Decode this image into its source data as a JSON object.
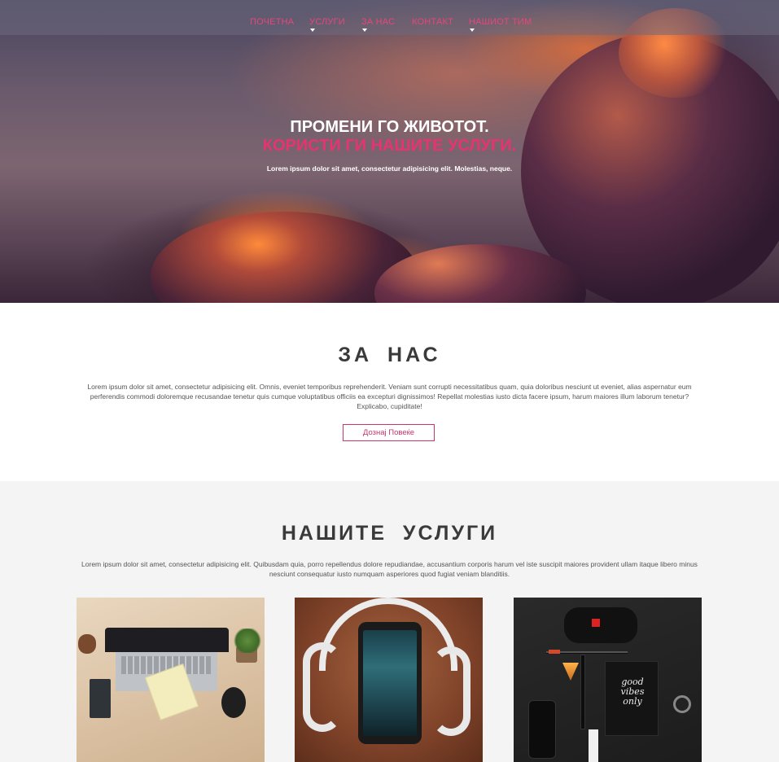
{
  "nav": {
    "items": [
      {
        "label": "ПОЧЕТНА",
        "dropdown": false
      },
      {
        "label": "УСЛУГИ",
        "dropdown": true
      },
      {
        "label": "ЗА НАС",
        "dropdown": true
      },
      {
        "label": "КОНТАКТ",
        "dropdown": false
      },
      {
        "label": "НАШИОТ ТИМ",
        "dropdown": true
      }
    ]
  },
  "hero": {
    "title": "ПРОМЕНИ ГО ЖИВОТОТ.",
    "subtitle": "КОРИСТИ ГИ НАШИТЕ УСЛУГИ.",
    "text": "Lorem ipsum dolor sit amet, consectetur adipisicing elit. Molestias, neque."
  },
  "about": {
    "title": "ЗА НАС",
    "text": "Lorem ipsum dolor sit amet, consectetur adipisicing elit. Omnis, eveniet temporibus reprehenderit. Veniam sunt corrupti necessitatibus quam, quia doloribus nesciunt ut eveniet, alias aspernatur eum perferendis commodi doloremque recusandae tenetur quis cumque voluptatibus officiis ea excepturi dignissimos! Repellat molestias iusto dicta facere ipsum, harum maiores illum laborum tenetur? Explicabo, cupiditate!",
    "button_label": "Дознај Повеќе"
  },
  "services": {
    "title": "НАШИТЕ УСЛУГИ",
    "text": "Lorem ipsum dolor sit amet, consectetur adipisicing elit. Quibusdam quia, porro repellendus dolore repudiandae, accusantium corporis harum vel iste suscipit maiores provident ullam itaque libero minus nesciunt consequatur iusto numquam asperiores quod fugiat veniam blanditiis.",
    "cards": [
      {
        "image": "laptop-desk-photo"
      },
      {
        "image": "phone-headphones-photo"
      },
      {
        "image": "flatlay-notebook-photo",
        "notebook_text": "good vibes only"
      }
    ]
  },
  "colors": {
    "accent": "#e8336f",
    "nav_text": "#e5477a",
    "button_border": "#c9346b",
    "section_bg": "#f4f4f4"
  }
}
